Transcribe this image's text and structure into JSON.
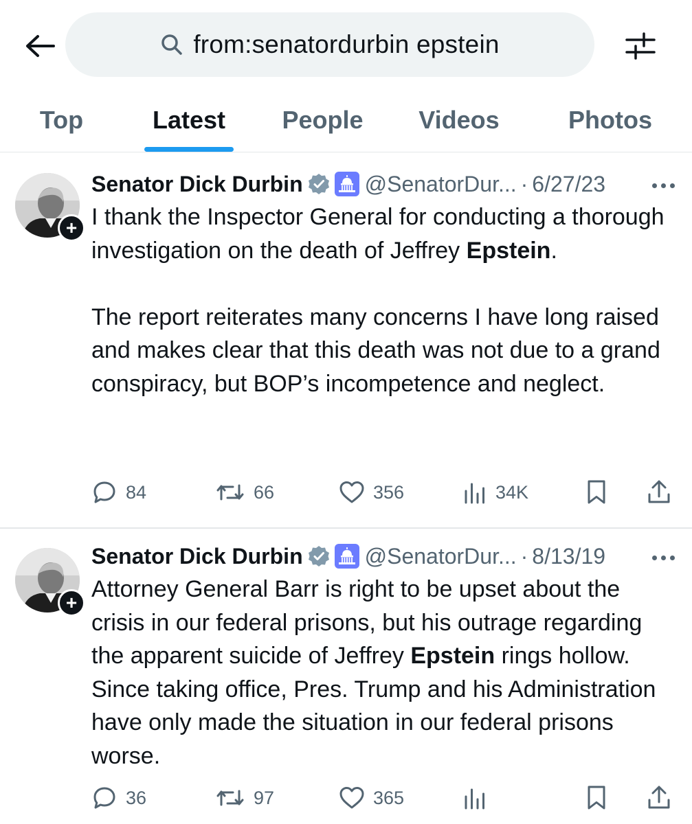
{
  "search": {
    "query": "from:senatordurbin epstein"
  },
  "tabs": [
    {
      "label": "Top"
    },
    {
      "label": "Latest"
    },
    {
      "label": "People"
    },
    {
      "label": "Videos"
    },
    {
      "label": "Photos"
    }
  ],
  "active_tab": "Latest",
  "colors": {
    "accent": "#1d9bf0",
    "verified": "#829aab",
    "gov_badge": "#6b7cff",
    "secondary_text": "#536471",
    "divider": "#e4e7e9"
  },
  "icons": {
    "back": "arrow-left-icon",
    "search": "search-icon",
    "filter": "sliders-icon",
    "verified": "verified-badge-icon",
    "gov": "capitol-icon",
    "reply": "reply-icon",
    "repost": "repost-icon",
    "like": "heart-icon",
    "views": "analytics-icon",
    "bookmark": "bookmark-icon",
    "share": "share-icon",
    "more": "more-icon",
    "follow": "plus-icon"
  },
  "posts": [
    {
      "display_name": "Senator Dick Durbin",
      "handle": "@SenatorDur...",
      "separator": "·",
      "date": "6/27/23",
      "body": {
        "p1_before": "I thank the Inspector General for conducting a thorough investigation on the death of Jeffrey ",
        "p1_bold": "Epstein",
        "p1_after": ".",
        "p2": "The report reiterates many concerns I have long raised and makes clear that this death was not due to a grand conspiracy, but BOP’s incompetence and neglect."
      },
      "replies": "84",
      "reposts": "66",
      "likes": "356",
      "views": "34K"
    },
    {
      "display_name": "Senator Dick Durbin",
      "handle": "@SenatorDur...",
      "separator": "·",
      "date": "8/13/19",
      "body": {
        "before": "Attorney General Barr is right to be upset about the crisis in our federal prisons, but his outrage regarding the apparent suicide of Jeffrey ",
        "bold": "Epstein",
        "after": " rings hollow. Since taking office, Pres. Trump and his Administration have only made the situation in our federal prisons worse."
      },
      "replies": "36",
      "reposts": "97",
      "likes": "365",
      "views": ""
    }
  ]
}
